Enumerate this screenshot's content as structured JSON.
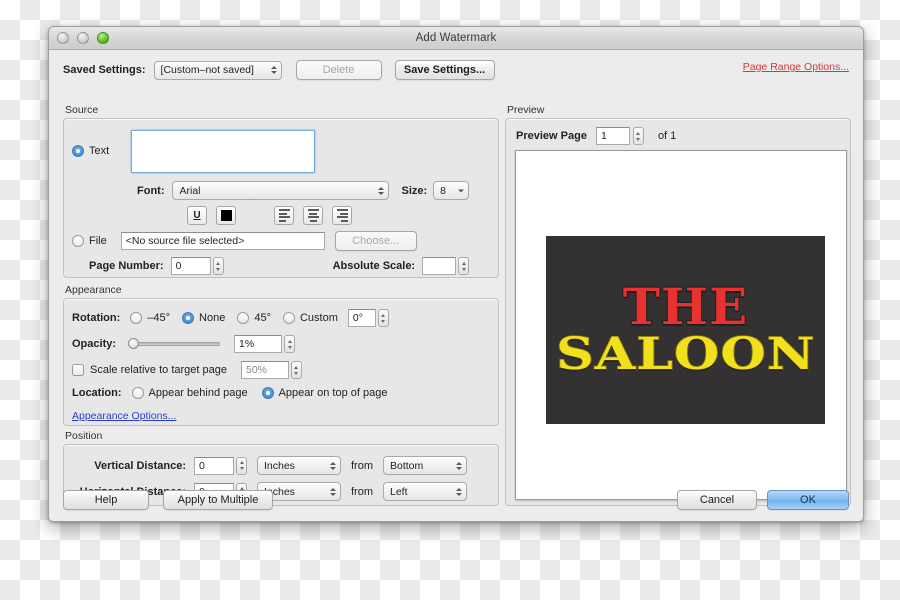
{
  "window": {
    "title": "Add Watermark",
    "traffic_lights": [
      "close-button",
      "minimize-button",
      "zoom-button"
    ]
  },
  "toolbar": {
    "saved_settings_label": "Saved Settings:",
    "saved_settings_value": "[Custom–not saved]",
    "delete_label": "Delete",
    "save_settings_label": "Save Settings...",
    "page_range_link": "Page Range Options..."
  },
  "source": {
    "group_title": "Source",
    "text_radio_label": "Text",
    "text_value": "",
    "font_label": "Font:",
    "font_value": "Arial",
    "size_label": "Size:",
    "size_value": "8",
    "underline_label": "U",
    "color_swatch": "#000000",
    "align_left": "align-left",
    "align_center": "align-center",
    "align_right": "align-right",
    "file_radio_label": "File",
    "file_value": "<No source file selected>",
    "choose_label": "Choose...",
    "page_number_label": "Page Number:",
    "page_number_value": "0",
    "absolute_scale_label": "Absolute Scale:",
    "absolute_scale_value": ""
  },
  "appearance": {
    "group_title": "Appearance",
    "rotation_label": "Rotation:",
    "rotation_options": [
      "–45°",
      "None",
      "45°",
      "Custom"
    ],
    "rotation_selected": "None",
    "custom_angle_value": "0°",
    "opacity_label": "Opacity:",
    "opacity_value": "1%",
    "scale_checkbox_label": "Scale relative to target page",
    "scale_value": "50%",
    "location_label": "Location:",
    "location_behind": "Appear behind page",
    "location_ontop": "Appear on top of page",
    "location_selected": "Appear on top of page",
    "appearance_options_link": "Appearance Options..."
  },
  "position": {
    "group_title": "Position",
    "vertical_label": "Vertical Distance:",
    "vertical_value": "0",
    "vertical_unit": "Inches",
    "vertical_from_word": "from",
    "vertical_from": "Bottom",
    "horizontal_label": "Horizontal Distance:",
    "horizontal_value": "0",
    "horizontal_unit": "Inches",
    "horizontal_from_word": "from",
    "horizontal_from": "Left"
  },
  "preview": {
    "group_title": "Preview",
    "page_label": "Preview Page",
    "page_value": "1",
    "of_text": "of 1",
    "artwork": {
      "line1": "THE",
      "line2": "SALOON",
      "background_color": "#333132",
      "line1_color": "#e8322f",
      "line2_color": "#f3e01c"
    }
  },
  "footer": {
    "help_label": "Help",
    "apply_label": "Apply to Multiple",
    "cancel_label": "Cancel",
    "ok_label": "OK"
  }
}
